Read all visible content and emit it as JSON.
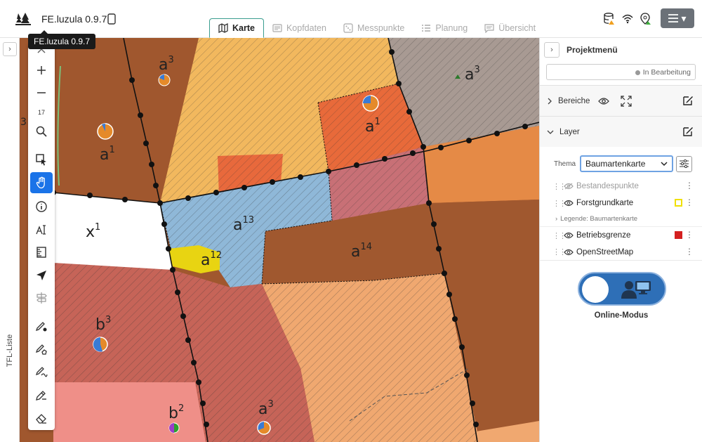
{
  "app": {
    "title": "FE.luzula 0.9.7",
    "tooltip": "FE.luzula 0.9.7"
  },
  "tabs": [
    {
      "label": "Karte",
      "icon": "map-icon",
      "active": true
    },
    {
      "label": "Kopfdaten",
      "icon": "card-icon",
      "active": false
    },
    {
      "label": "Messpunkte",
      "icon": "dice-icon",
      "active": false
    },
    {
      "label": "Planung",
      "icon": "list-icon",
      "active": false
    },
    {
      "label": "Übersicht",
      "icon": "comment-icon",
      "active": false
    }
  ],
  "status_icons": [
    "database-warning-icon",
    "wifi-icon",
    "location-icon"
  ],
  "menu_button": {
    "icon": "hamburger-icon",
    "caret": "▾"
  },
  "left_strip": {
    "label": "TFL-Liste",
    "toggle": "›"
  },
  "toolbar": {
    "zoom_level": "17",
    "tools": [
      "zoom-in-icon",
      "zoom-out-icon",
      "search-icon",
      "select-icon",
      "pan-icon",
      "info-icon",
      "measure-height-icon",
      "ruler-icon",
      "navigate-icon",
      "signpost-icon",
      "draw-point-icon",
      "draw-polygon-icon",
      "draw-line-icon",
      "edit-icon",
      "eraser-icon"
    ],
    "active_tool": "pan-icon"
  },
  "map_labels": [
    {
      "base": "a",
      "sup": "3"
    },
    {
      "base": "a",
      "sup": "1"
    },
    {
      "base": "a",
      "sup": "3"
    },
    {
      "base": "a",
      "sup": "1"
    },
    {
      "base": "x",
      "sup": "1"
    },
    {
      "base": "a",
      "sup": "13"
    },
    {
      "base": "a",
      "sup": "12"
    },
    {
      "base": "a",
      "sup": "14"
    },
    {
      "base": "b",
      "sup": "3"
    },
    {
      "base": "b",
      "sup": "2"
    },
    {
      "base": "a",
      "sup": "3"
    },
    {
      "base": "3",
      "sup": ""
    }
  ],
  "panel": {
    "title": "Projektmenü",
    "toggle": "›",
    "project_status": "In Bearbeitung",
    "sections": {
      "bereiche": "Bereiche",
      "layer": "Layer"
    },
    "theme_label": "Thema",
    "theme_value": "Baumartenkarte",
    "layers": [
      {
        "name": "Bestandespunkte",
        "visible": false,
        "swatch": null
      },
      {
        "name": "Forstgrundkarte",
        "visible": true,
        "swatch": "#f0e000"
      },
      {
        "name": "Betriebsgrenze",
        "visible": true,
        "swatch": "#d42020"
      },
      {
        "name": "OpenStreetMap",
        "visible": true,
        "swatch": null
      }
    ],
    "legend_text": "Legende: Baumartenkarte",
    "online_mode_label": "Online-Modus"
  },
  "colors": {
    "accent": "#1a73e8",
    "toggle": "#2e6fb7",
    "tab_border": "#3a9d8f",
    "brown": "#a0572e",
    "orange": "#e8873f",
    "blue": "#8fb8d8"
  }
}
